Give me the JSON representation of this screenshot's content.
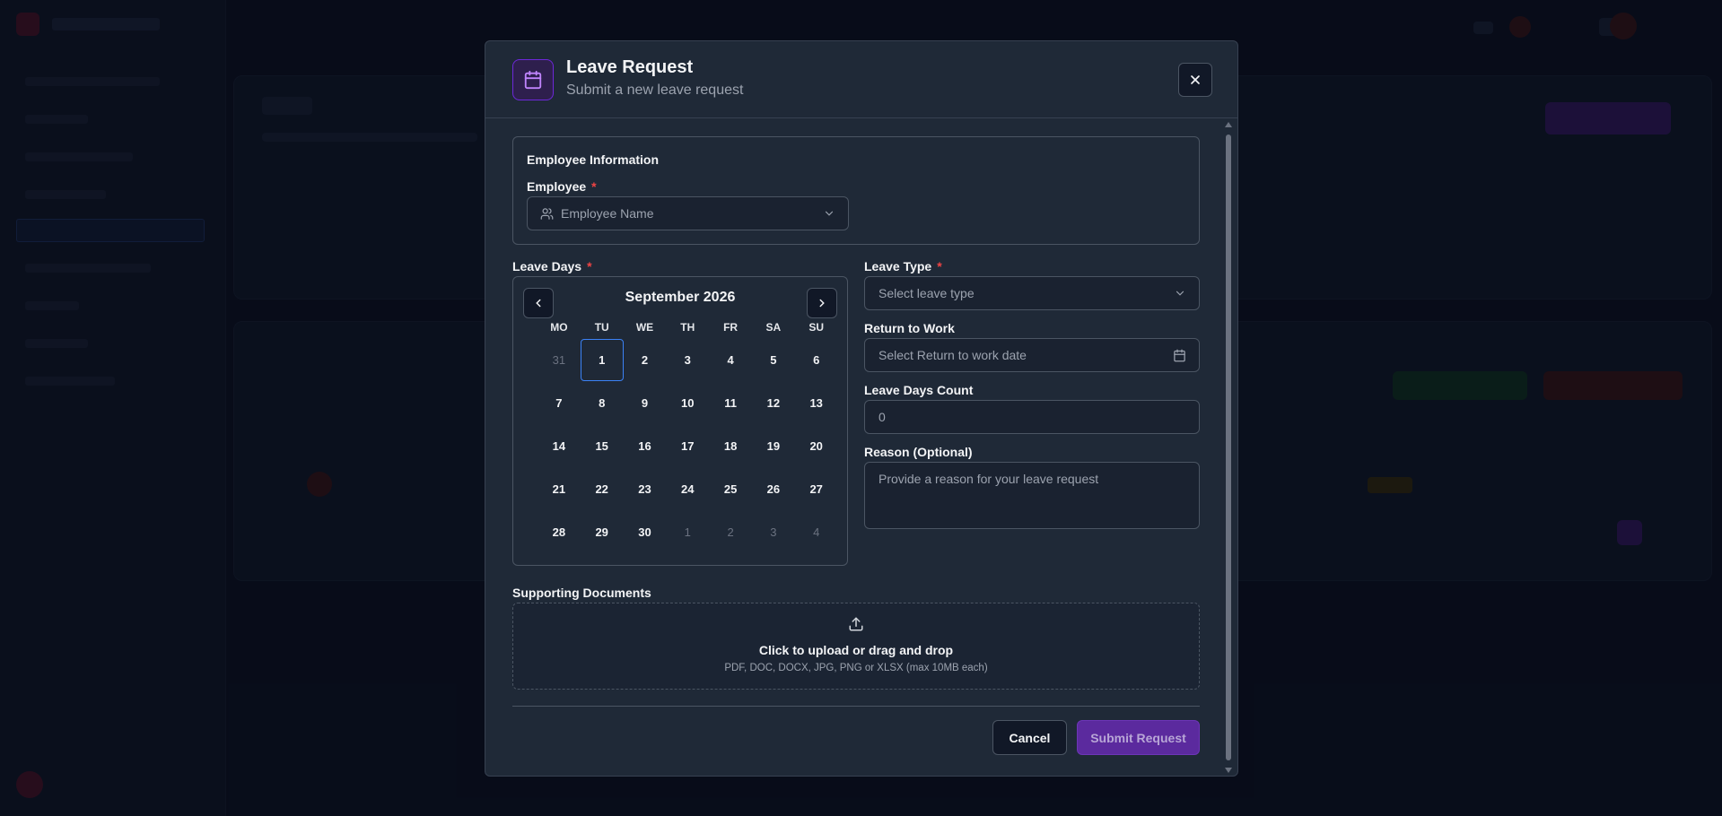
{
  "modal": {
    "title": "Leave Request",
    "subtitle": "Submit a new leave request",
    "close_icon": "close-icon",
    "header_icon": "calendar-icon"
  },
  "employee_section": {
    "title": "Employee Information",
    "employee_label": "Employee",
    "required_mark": "*",
    "employee_placeholder": "Employee Name"
  },
  "leave_days": {
    "label": "Leave Days",
    "required_mark": "*",
    "calendar": {
      "month_label": "September 2026",
      "weekdays": [
        "MO",
        "TU",
        "WE",
        "TH",
        "FR",
        "SA",
        "SU"
      ],
      "days": [
        {
          "d": "31",
          "muted": true
        },
        {
          "d": "1",
          "selected": true
        },
        {
          "d": "2"
        },
        {
          "d": "3"
        },
        {
          "d": "4"
        },
        {
          "d": "5"
        },
        {
          "d": "6"
        },
        {
          "d": "7"
        },
        {
          "d": "8"
        },
        {
          "d": "9"
        },
        {
          "d": "10"
        },
        {
          "d": "11"
        },
        {
          "d": "12"
        },
        {
          "d": "13"
        },
        {
          "d": "14"
        },
        {
          "d": "15"
        },
        {
          "d": "16"
        },
        {
          "d": "17"
        },
        {
          "d": "18"
        },
        {
          "d": "19"
        },
        {
          "d": "20"
        },
        {
          "d": "21"
        },
        {
          "d": "22"
        },
        {
          "d": "23"
        },
        {
          "d": "24"
        },
        {
          "d": "25"
        },
        {
          "d": "26"
        },
        {
          "d": "27"
        },
        {
          "d": "28"
        },
        {
          "d": "29"
        },
        {
          "d": "30"
        },
        {
          "d": "1",
          "muted": true
        },
        {
          "d": "2",
          "muted": true
        },
        {
          "d": "3",
          "muted": true
        },
        {
          "d": "4",
          "muted": true
        }
      ]
    }
  },
  "leave_type": {
    "label": "Leave Type",
    "required_mark": "*",
    "placeholder": "Select leave type"
  },
  "return_to_work": {
    "label": "Return to Work",
    "placeholder": "Select Return to work date"
  },
  "leave_days_count": {
    "label": "Leave Days Count",
    "value": "0"
  },
  "reason": {
    "label": "Reason (Optional)",
    "placeholder": "Provide a reason for your leave request"
  },
  "documents": {
    "label": "Supporting Documents",
    "upload_title": "Click to upload or drag and drop",
    "upload_hint": "PDF, DOC, DOCX, JPG, PNG or XLSX (max 10MB each)"
  },
  "footer": {
    "cancel_label": "Cancel",
    "submit_label": "Submit Request"
  },
  "colors": {
    "accent": "#5b2a9e",
    "required": "#ef4444",
    "selected_day_border": "#3b82f6"
  }
}
